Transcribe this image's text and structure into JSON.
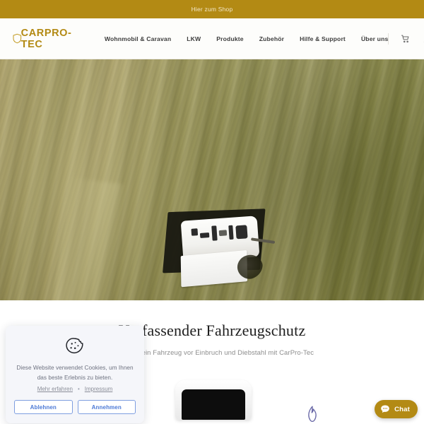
{
  "announcement": {
    "label": "Hier zum Shop"
  },
  "header": {
    "logo_text": "CARPRO-TEC",
    "logo_icon": "shield-icon",
    "nav": [
      {
        "label": "Wohnmobil & Caravan"
      },
      {
        "label": "LKW"
      },
      {
        "label": "Produkte"
      },
      {
        "label": "Zubehör"
      },
      {
        "label": "Hilfe & Support"
      },
      {
        "label": "Über uns"
      }
    ],
    "cart_icon": "shopping-cart-icon",
    "account_icon": "user-account-icon"
  },
  "hero": {
    "alt": "Aerial view of a white caravan parked on a mown grass field"
  },
  "main": {
    "headline": "Umfassender Fahrzeugschutz",
    "subline": "Schütze Dein Fahrzeug vor Einbruch und Diebstahl mit CarPro-Tec",
    "flame_icon": "flame-icon"
  },
  "cookie_consent": {
    "icon": "cookie-icon",
    "text": "Diese Website verwendet Cookies, um Ihnen das beste Erlebnis zu bieten.",
    "links": [
      {
        "label": "Mehr erfahren"
      },
      {
        "label": "Impressum"
      }
    ],
    "separator": "•",
    "decline_label": "Ablehnen",
    "accept_label": "Annehmen"
  },
  "chat_widget": {
    "label": "Chat",
    "icon": "chat-bubble-icon"
  },
  "colors": {
    "brand_gold": "#b38a14",
    "announcement_bg": "#b38a14",
    "announcement_text": "#f3e7c8",
    "nav_text": "#3d3d3d",
    "headline": "#1e1e1e",
    "subline": "#8d8d8d",
    "cookie_bg": "#f5f6fa",
    "cookie_button_border": "#7e9ee0",
    "cookie_button_text": "#4d7ad6",
    "flame": "#6b6aa8",
    "chat_bg": "#b38a14"
  }
}
